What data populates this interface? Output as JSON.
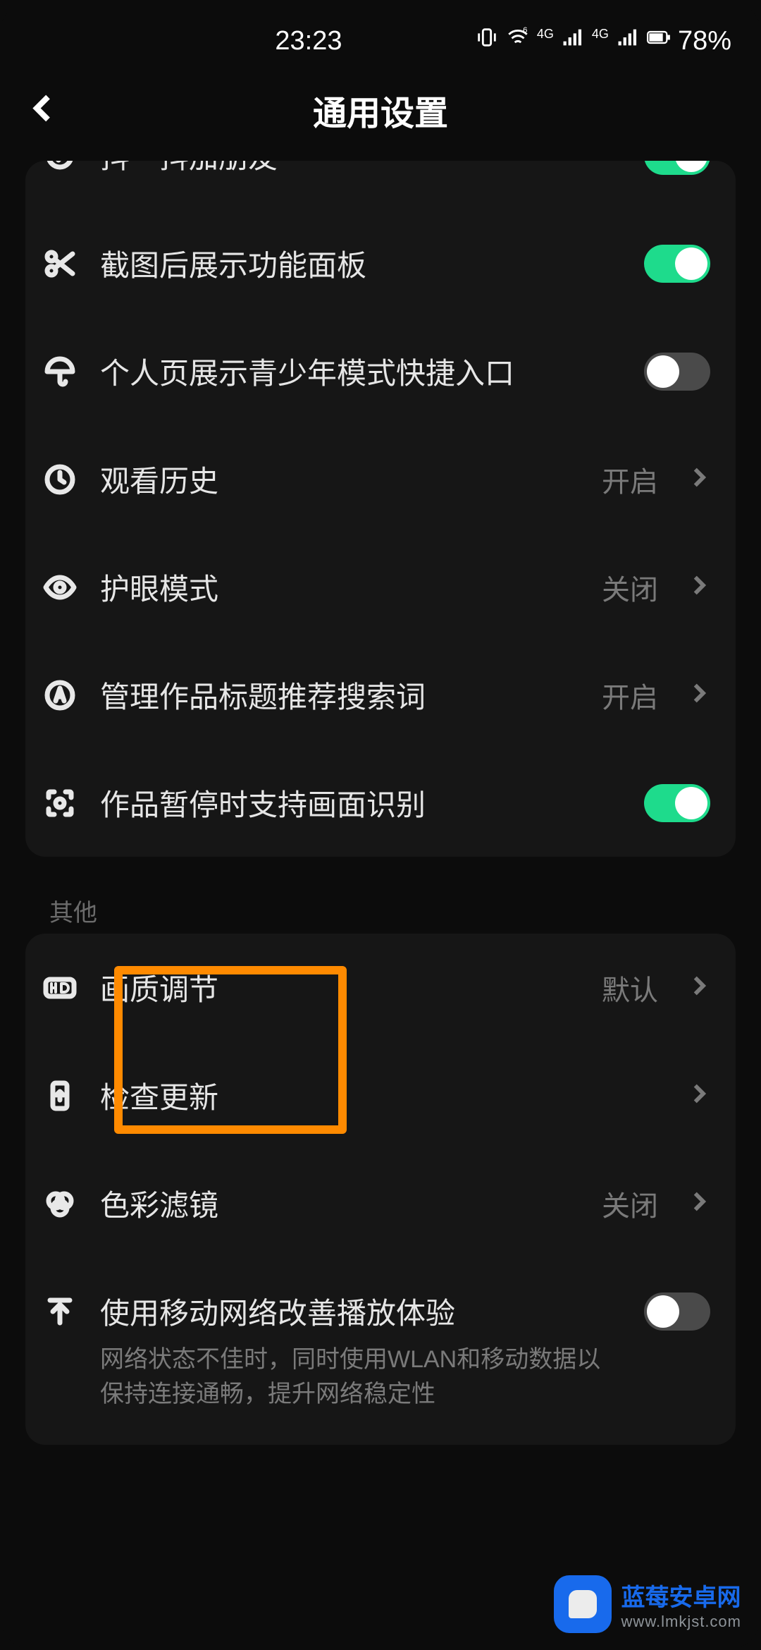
{
  "status": {
    "time": "23:23",
    "battery": "78%"
  },
  "header": {
    "title": "通用设置"
  },
  "sections": [
    {
      "rows": {
        "shake": {
          "label": "抖一抖加朋友"
        },
        "screenshot_panel": {
          "label": "截图后展示功能面板"
        },
        "youth_mode_shortcut": {
          "label": "个人页展示青少年模式快捷入口"
        },
        "watch_history": {
          "label": "观看历史",
          "value": "开启"
        },
        "eye_care": {
          "label": "护眼模式",
          "value": "关闭"
        },
        "title_keywords": {
          "label": "管理作品标题推荐搜索词",
          "value": "开启"
        },
        "pause_recognition": {
          "label": "作品暂停时支持画面识别"
        }
      }
    },
    {
      "title": "其他",
      "rows": {
        "quality": {
          "label": "画质调节",
          "value": "默认"
        },
        "update": {
          "label": "检查更新"
        },
        "color_filter": {
          "label": "色彩滤镜",
          "value": "关闭"
        },
        "mobile_improve": {
          "label": "使用移动网络改善播放体验",
          "desc": "网络状态不佳时，同时使用WLAN和移动数据以保持连接通畅，提升网络稳定性"
        }
      }
    }
  ],
  "watermark": {
    "name": "蓝莓安卓网",
    "url": "www.lmkjst.com"
  }
}
